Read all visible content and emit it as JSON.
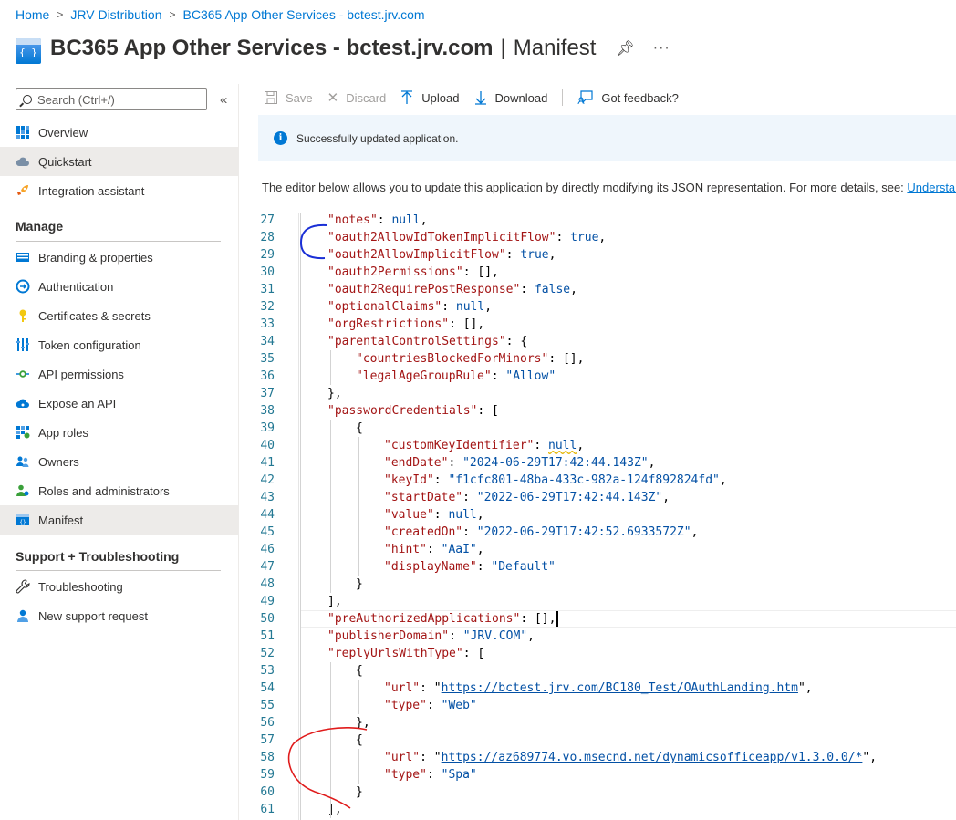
{
  "breadcrumb": [
    "Home",
    "JRV Distribution",
    "BC365 App Other Services - bctest.jrv.com"
  ],
  "header": {
    "title": "BC365 App Other Services - bctest.jrv.com",
    "separator": "|",
    "subtitle": "Manifest",
    "icon_text": "{ }",
    "more": "···"
  },
  "sidebar": {
    "search_placeholder": "Search (Ctrl+/)",
    "collapse": "«",
    "top_items": [
      {
        "label": "Overview",
        "icon": "grid-icon"
      },
      {
        "label": "Quickstart",
        "icon": "cloud-icon"
      },
      {
        "label": "Integration assistant",
        "icon": "rocket-icon"
      }
    ],
    "manage_header": "Manage",
    "manage_items": [
      {
        "label": "Branding & properties",
        "icon": "branding-icon"
      },
      {
        "label": "Authentication",
        "icon": "auth-icon"
      },
      {
        "label": "Certificates & secrets",
        "icon": "key-icon"
      },
      {
        "label": "Token configuration",
        "icon": "token-icon"
      },
      {
        "label": "API permissions",
        "icon": "api-icon"
      },
      {
        "label": "Expose an API",
        "icon": "cloud-api-icon"
      },
      {
        "label": "App roles",
        "icon": "app-roles-icon"
      },
      {
        "label": "Owners",
        "icon": "owners-icon"
      },
      {
        "label": "Roles and administrators",
        "icon": "roles-icon"
      },
      {
        "label": "Manifest",
        "icon": "manifest-icon"
      }
    ],
    "support_header": "Support + Troubleshooting",
    "support_items": [
      {
        "label": "Troubleshooting",
        "icon": "wrench-icon"
      },
      {
        "label": "New support request",
        "icon": "support-icon"
      }
    ]
  },
  "toolbar": {
    "save": "Save",
    "discard": "Discard",
    "upload": "Upload",
    "download": "Download",
    "feedback": "Got feedback?"
  },
  "banner": {
    "message": "Successfully updated application."
  },
  "description": {
    "text": "The editor below allows you to update this application by directly modifying its JSON representation. For more details, see: ",
    "link": "Understand the Azure Active Directory application manifest"
  },
  "editor": {
    "lines": [
      {
        "n": "27",
        "indent": 1,
        "tokens": [
          [
            "k",
            "\"notes\""
          ],
          [
            "p",
            ": "
          ],
          [
            "n",
            "null"
          ],
          [
            "p",
            ","
          ]
        ]
      },
      {
        "n": "28",
        "indent": 1,
        "tokens": [
          [
            "k",
            "\"oauth2AllowIdTokenImplicitFlow\""
          ],
          [
            "p",
            ": "
          ],
          [
            "n",
            "true"
          ],
          [
            "p",
            ","
          ]
        ]
      },
      {
        "n": "29",
        "indent": 1,
        "tokens": [
          [
            "k",
            "\"oauth2AllowImplicitFlow\""
          ],
          [
            "p",
            ": "
          ],
          [
            "n",
            "true"
          ],
          [
            "p",
            ","
          ]
        ]
      },
      {
        "n": "30",
        "indent": 1,
        "tokens": [
          [
            "k",
            "\"oauth2Permissions\""
          ],
          [
            "p",
            ": [],"
          ]
        ]
      },
      {
        "n": "31",
        "indent": 1,
        "tokens": [
          [
            "k",
            "\"oauth2RequirePostResponse\""
          ],
          [
            "p",
            ": "
          ],
          [
            "n",
            "false"
          ],
          [
            "p",
            ","
          ]
        ]
      },
      {
        "n": "32",
        "indent": 1,
        "tokens": [
          [
            "k",
            "\"optionalClaims\""
          ],
          [
            "p",
            ": "
          ],
          [
            "n",
            "null"
          ],
          [
            "p",
            ","
          ]
        ]
      },
      {
        "n": "33",
        "indent": 1,
        "tokens": [
          [
            "k",
            "\"orgRestrictions\""
          ],
          [
            "p",
            ": [],"
          ]
        ]
      },
      {
        "n": "34",
        "indent": 1,
        "tokens": [
          [
            "k",
            "\"parentalControlSettings\""
          ],
          [
            "p",
            ": {"
          ]
        ]
      },
      {
        "n": "35",
        "indent": 2,
        "tokens": [
          [
            "k",
            "\"countriesBlockedForMinors\""
          ],
          [
            "p",
            ": [],"
          ]
        ]
      },
      {
        "n": "36",
        "indent": 2,
        "tokens": [
          [
            "k",
            "\"legalAgeGroupRule\""
          ],
          [
            "p",
            ": "
          ],
          [
            "v",
            "\"Allow\""
          ]
        ]
      },
      {
        "n": "37",
        "indent": 1,
        "tokens": [
          [
            "p",
            "},"
          ]
        ]
      },
      {
        "n": "38",
        "indent": 1,
        "tokens": [
          [
            "k",
            "\"passwordCredentials\""
          ],
          [
            "p",
            ": ["
          ]
        ]
      },
      {
        "n": "39",
        "indent": 2,
        "tokens": [
          [
            "p",
            "{"
          ]
        ]
      },
      {
        "n": "40",
        "indent": 3,
        "tokens": [
          [
            "k",
            "\"customKeyIdentifier\""
          ],
          [
            "p",
            ": "
          ],
          [
            "sq",
            "null"
          ],
          [
            "p",
            ","
          ]
        ]
      },
      {
        "n": "41",
        "indent": 3,
        "tokens": [
          [
            "k",
            "\"endDate\""
          ],
          [
            "p",
            ": "
          ],
          [
            "v",
            "\"2024-06-29T17:42:44.143Z\""
          ],
          [
            "p",
            ","
          ]
        ]
      },
      {
        "n": "42",
        "indent": 3,
        "tokens": [
          [
            "k",
            "\"keyId\""
          ],
          [
            "p",
            ": "
          ],
          [
            "v",
            "\"f1cfc801-48ba-433c-982a-124f892824fd\""
          ],
          [
            "p",
            ","
          ]
        ]
      },
      {
        "n": "43",
        "indent": 3,
        "tokens": [
          [
            "k",
            "\"startDate\""
          ],
          [
            "p",
            ": "
          ],
          [
            "v",
            "\"2022-06-29T17:42:44.143Z\""
          ],
          [
            "p",
            ","
          ]
        ]
      },
      {
        "n": "44",
        "indent": 3,
        "tokens": [
          [
            "k",
            "\"value\""
          ],
          [
            "p",
            ": "
          ],
          [
            "n",
            "null"
          ],
          [
            "p",
            ","
          ]
        ]
      },
      {
        "n": "45",
        "indent": 3,
        "tokens": [
          [
            "k",
            "\"createdOn\""
          ],
          [
            "p",
            ": "
          ],
          [
            "v",
            "\"2022-06-29T17:42:52.6933572Z\""
          ],
          [
            "p",
            ","
          ]
        ]
      },
      {
        "n": "46",
        "indent": 3,
        "tokens": [
          [
            "k",
            "\"hint\""
          ],
          [
            "p",
            ": "
          ],
          [
            "v",
            "\"AaI\""
          ],
          [
            "p",
            ","
          ]
        ]
      },
      {
        "n": "47",
        "indent": 3,
        "tokens": [
          [
            "k",
            "\"displayName\""
          ],
          [
            "p",
            ": "
          ],
          [
            "v",
            "\"Default\""
          ]
        ]
      },
      {
        "n": "48",
        "indent": 2,
        "tokens": [
          [
            "p",
            "}"
          ]
        ]
      },
      {
        "n": "49",
        "indent": 1,
        "tokens": [
          [
            "p",
            "],"
          ]
        ]
      },
      {
        "n": "50",
        "indent": 1,
        "tokens": [
          [
            "k",
            "\"preAuthorizedApplications\""
          ],
          [
            "p",
            ": [],"
          ]
        ]
      },
      {
        "n": "51",
        "indent": 1,
        "tokens": [
          [
            "k",
            "\"publisherDomain\""
          ],
          [
            "p",
            ": "
          ],
          [
            "v",
            "\"JRV.COM\""
          ],
          [
            "p",
            ","
          ]
        ]
      },
      {
        "n": "52",
        "indent": 1,
        "tokens": [
          [
            "k",
            "\"replyUrlsWithType\""
          ],
          [
            "p",
            ": ["
          ]
        ]
      },
      {
        "n": "53",
        "indent": 2,
        "tokens": [
          [
            "p",
            "{"
          ]
        ]
      },
      {
        "n": "54",
        "indent": 3,
        "tokens": [
          [
            "k",
            "\"url\""
          ],
          [
            "p",
            ": \""
          ],
          [
            "u",
            "https://bctest.jrv.com/BC180_Test/OAuthLanding.htm"
          ],
          [
            "p",
            "\","
          ]
        ]
      },
      {
        "n": "55",
        "indent": 3,
        "tokens": [
          [
            "k",
            "\"type\""
          ],
          [
            "p",
            ": "
          ],
          [
            "v",
            "\"Web\""
          ]
        ]
      },
      {
        "n": "56",
        "indent": 2,
        "tokens": [
          [
            "p",
            "},"
          ]
        ]
      },
      {
        "n": "57",
        "indent": 2,
        "tokens": [
          [
            "p",
            "{"
          ]
        ]
      },
      {
        "n": "58",
        "indent": 3,
        "tokens": [
          [
            "k",
            "\"url\""
          ],
          [
            "p",
            ": \""
          ],
          [
            "u",
            "https://az689774.vo.msecnd.net/dynamicsofficeapp/v1.3.0.0/*"
          ],
          [
            "p",
            "\","
          ]
        ]
      },
      {
        "n": "59",
        "indent": 3,
        "tokens": [
          [
            "k",
            "\"type\""
          ],
          [
            "p",
            ": "
          ],
          [
            "v",
            "\"Spa\""
          ]
        ]
      },
      {
        "n": "60",
        "indent": 2,
        "tokens": [
          [
            "p",
            "}"
          ]
        ]
      },
      {
        "n": "61",
        "indent": 1,
        "tokens": [
          [
            "p",
            "],"
          ]
        ]
      }
    ],
    "current_line": "50"
  },
  "colors": {
    "accent": "#0078d4",
    "annotation_blue": "#1a2fd6",
    "annotation_red": "#e01b1b"
  }
}
